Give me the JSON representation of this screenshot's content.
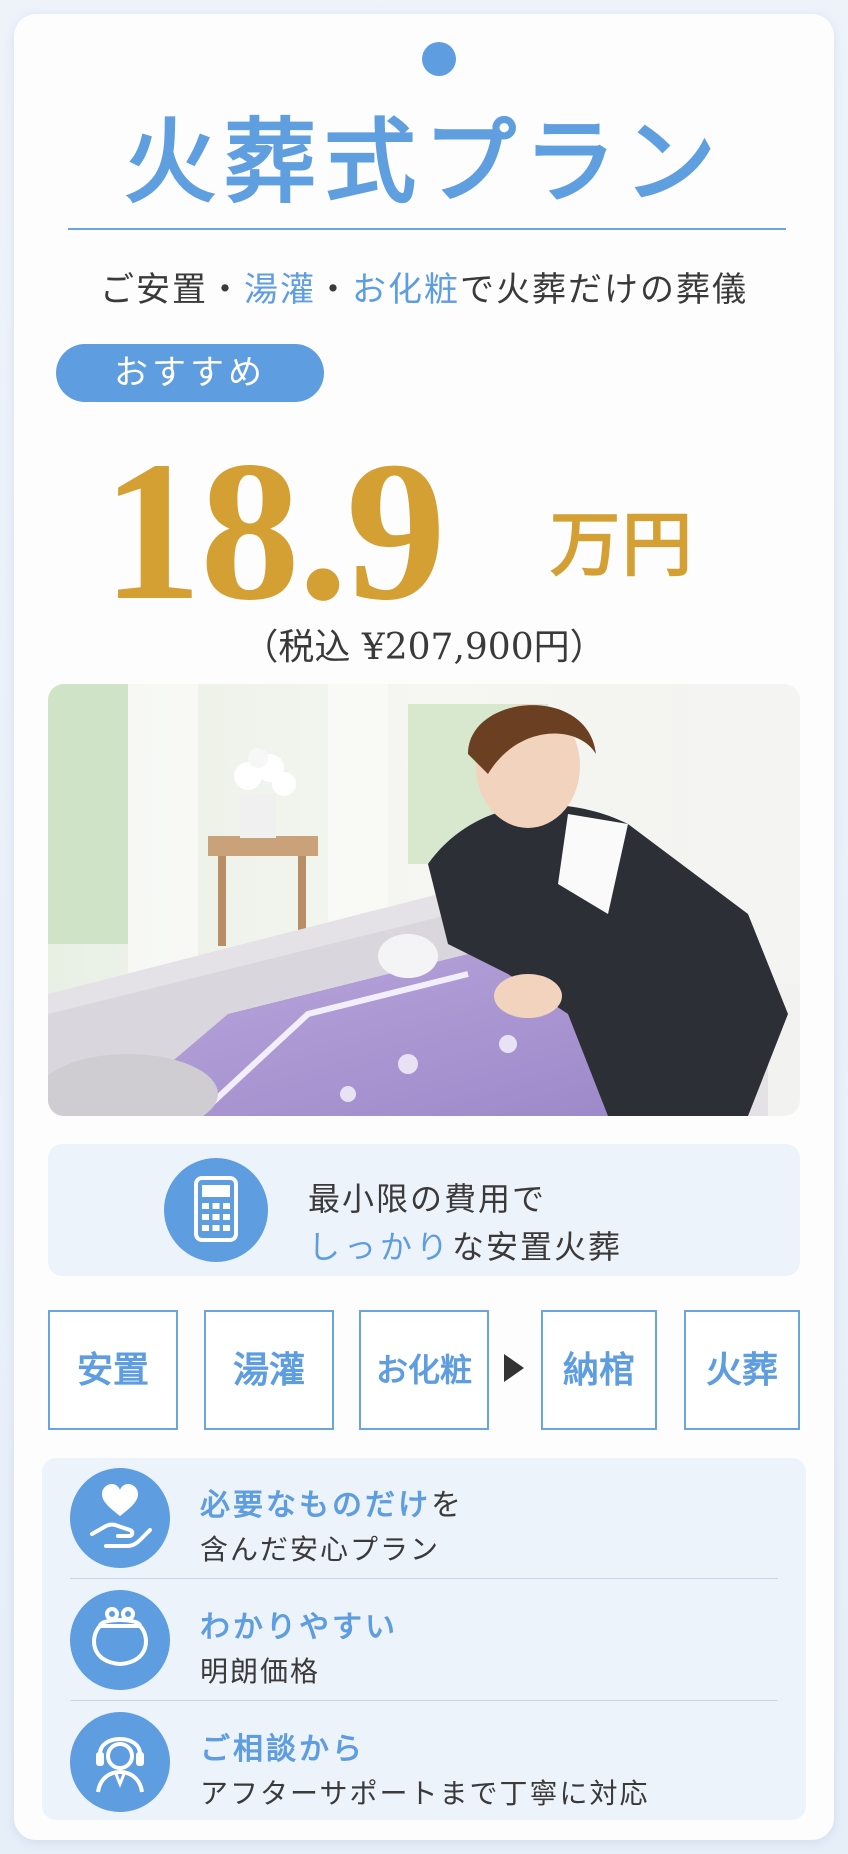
{
  "title": "火葬式プラン",
  "subtitle": {
    "part1": "ご安置・",
    "hl1": "湯灌",
    "part2": "・",
    "hl2": "お化粧",
    "part3": "で火葬だけの葬儀"
  },
  "badge": "おすすめ",
  "price": {
    "amount": "18.9",
    "unit": "万円",
    "tax_included": "（税込 ¥207,900円）"
  },
  "feature": {
    "icon": "calculator-icon",
    "line1": "最小限の費用で",
    "line2_hl": "しっかり",
    "line2_rest": "な安置火葬"
  },
  "steps": [
    "安置",
    "湯灌",
    "お化粧",
    "納棺",
    "火葬"
  ],
  "benefits": [
    {
      "icon": "heart-hand-icon",
      "title_hl": "必要なものだけ",
      "title_rest": "を",
      "desc": "含んだ安心プラン"
    },
    {
      "icon": "coin-purse-icon",
      "title_hl": "わかりやすい",
      "title_rest": "",
      "desc": "明朗価格"
    },
    {
      "icon": "support-headset-icon",
      "title_hl": "ご相談から",
      "title_rest": "",
      "desc": "アフターサポートまで丁寧に対応"
    }
  ],
  "colors": {
    "accent": "#5e9de0",
    "gold": "#d4a034",
    "text": "#3a3a3a",
    "panel": "#edf3fb"
  }
}
